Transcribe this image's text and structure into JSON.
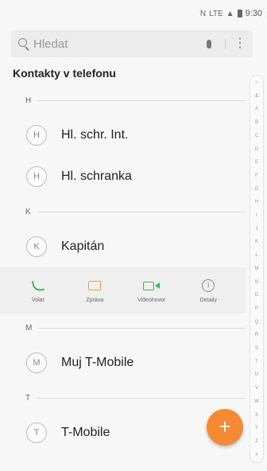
{
  "status_bar": {
    "icons": [
      "nfc-icon",
      "lte-icon",
      "signal-icon",
      "battery-icon"
    ],
    "nfc_text": "N",
    "lte_text": "LTE",
    "signal_text": "▲",
    "time": "9:30"
  },
  "search": {
    "placeholder": "Hledat",
    "more_glyph": "⋮"
  },
  "section_title": "Kontakty v telefonu",
  "letters": [
    "H",
    "K",
    "M",
    "T"
  ],
  "contacts": [
    {
      "initial": "H",
      "name": "Hl. schr. Int."
    },
    {
      "initial": "H",
      "name": "Hl. schranka"
    },
    {
      "initial": "K",
      "name": "Kapitán"
    },
    {
      "initial": "M",
      "name": "Muj T-Mobile"
    },
    {
      "initial": "T",
      "name": "T-Mobile"
    }
  ],
  "actions": [
    {
      "icon": "phone-icon",
      "label": "Volat"
    },
    {
      "icon": "message-icon",
      "label": "Zpráva"
    },
    {
      "icon": "video-call-icon",
      "label": "Videohovor"
    },
    {
      "icon": "info-icon",
      "label": "Detaily"
    }
  ],
  "info_glyph": "i",
  "index_letters": [
    "☆",
    "&",
    "A",
    "B",
    "C",
    "D",
    "E",
    "F",
    "G",
    "H",
    "I",
    "J",
    "K",
    "L",
    "M",
    "N",
    "O",
    "P",
    "Q",
    "R",
    "S",
    "T",
    "U",
    "V",
    "W",
    "X",
    "Y",
    "Z",
    "#"
  ],
  "fab": {
    "icon": "add-icon",
    "glyph": "+"
  },
  "colors": {
    "accent": "#f58a34",
    "call_green": "#4caf50",
    "message_orange": "#f0a030"
  }
}
